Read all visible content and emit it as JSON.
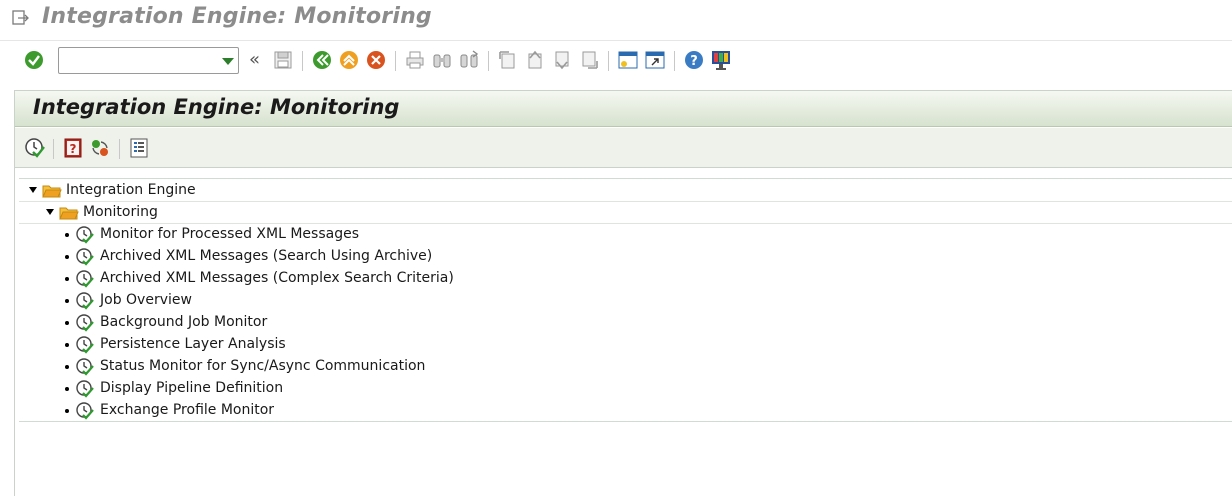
{
  "window": {
    "title": "Integration Engine: Monitoring"
  },
  "system_toolbar": {
    "command_field": {
      "value": "",
      "placeholder": ""
    },
    "icons": [
      "enter-icon",
      "save-icon",
      "back-icon",
      "exit-icon",
      "cancel-icon",
      "print-icon",
      "find-icon",
      "find-next-icon",
      "first-page-icon",
      "previous-page-icon",
      "next-page-icon",
      "last-page-icon",
      "create-session-icon",
      "create-shortcut-icon",
      "help-icon",
      "customize-layout-icon"
    ],
    "chevron_glyph": "«"
  },
  "screen": {
    "title": "Integration Engine: Monitoring",
    "toolbar_icons": [
      "execute-icon",
      "documentation-icon",
      "refresh-icon",
      "list-icon"
    ]
  },
  "tree": {
    "root": {
      "label": "Integration Engine",
      "expanded": true
    },
    "folder": {
      "label": "Monitoring",
      "expanded": true
    },
    "items": [
      {
        "label": "Monitor for Processed XML Messages"
      },
      {
        "label": "Archived XML Messages (Search Using Archive)"
      },
      {
        "label": "Archived XML Messages (Complex Search Criteria)"
      },
      {
        "label": "Job Overview"
      },
      {
        "label": "Background Job Monitor"
      },
      {
        "label": "Persistence Layer Analysis"
      },
      {
        "label": "Status Monitor for Sync/Async Communication"
      },
      {
        "label": "Display Pipeline Definition"
      },
      {
        "label": "Exchange Profile Monitor"
      }
    ]
  },
  "colors": {
    "title_gray": "#8c8c8c",
    "title_area_green": "#d7e2cf",
    "enter_green": "#3c9b2c",
    "folder_orange": "#f0a020"
  }
}
